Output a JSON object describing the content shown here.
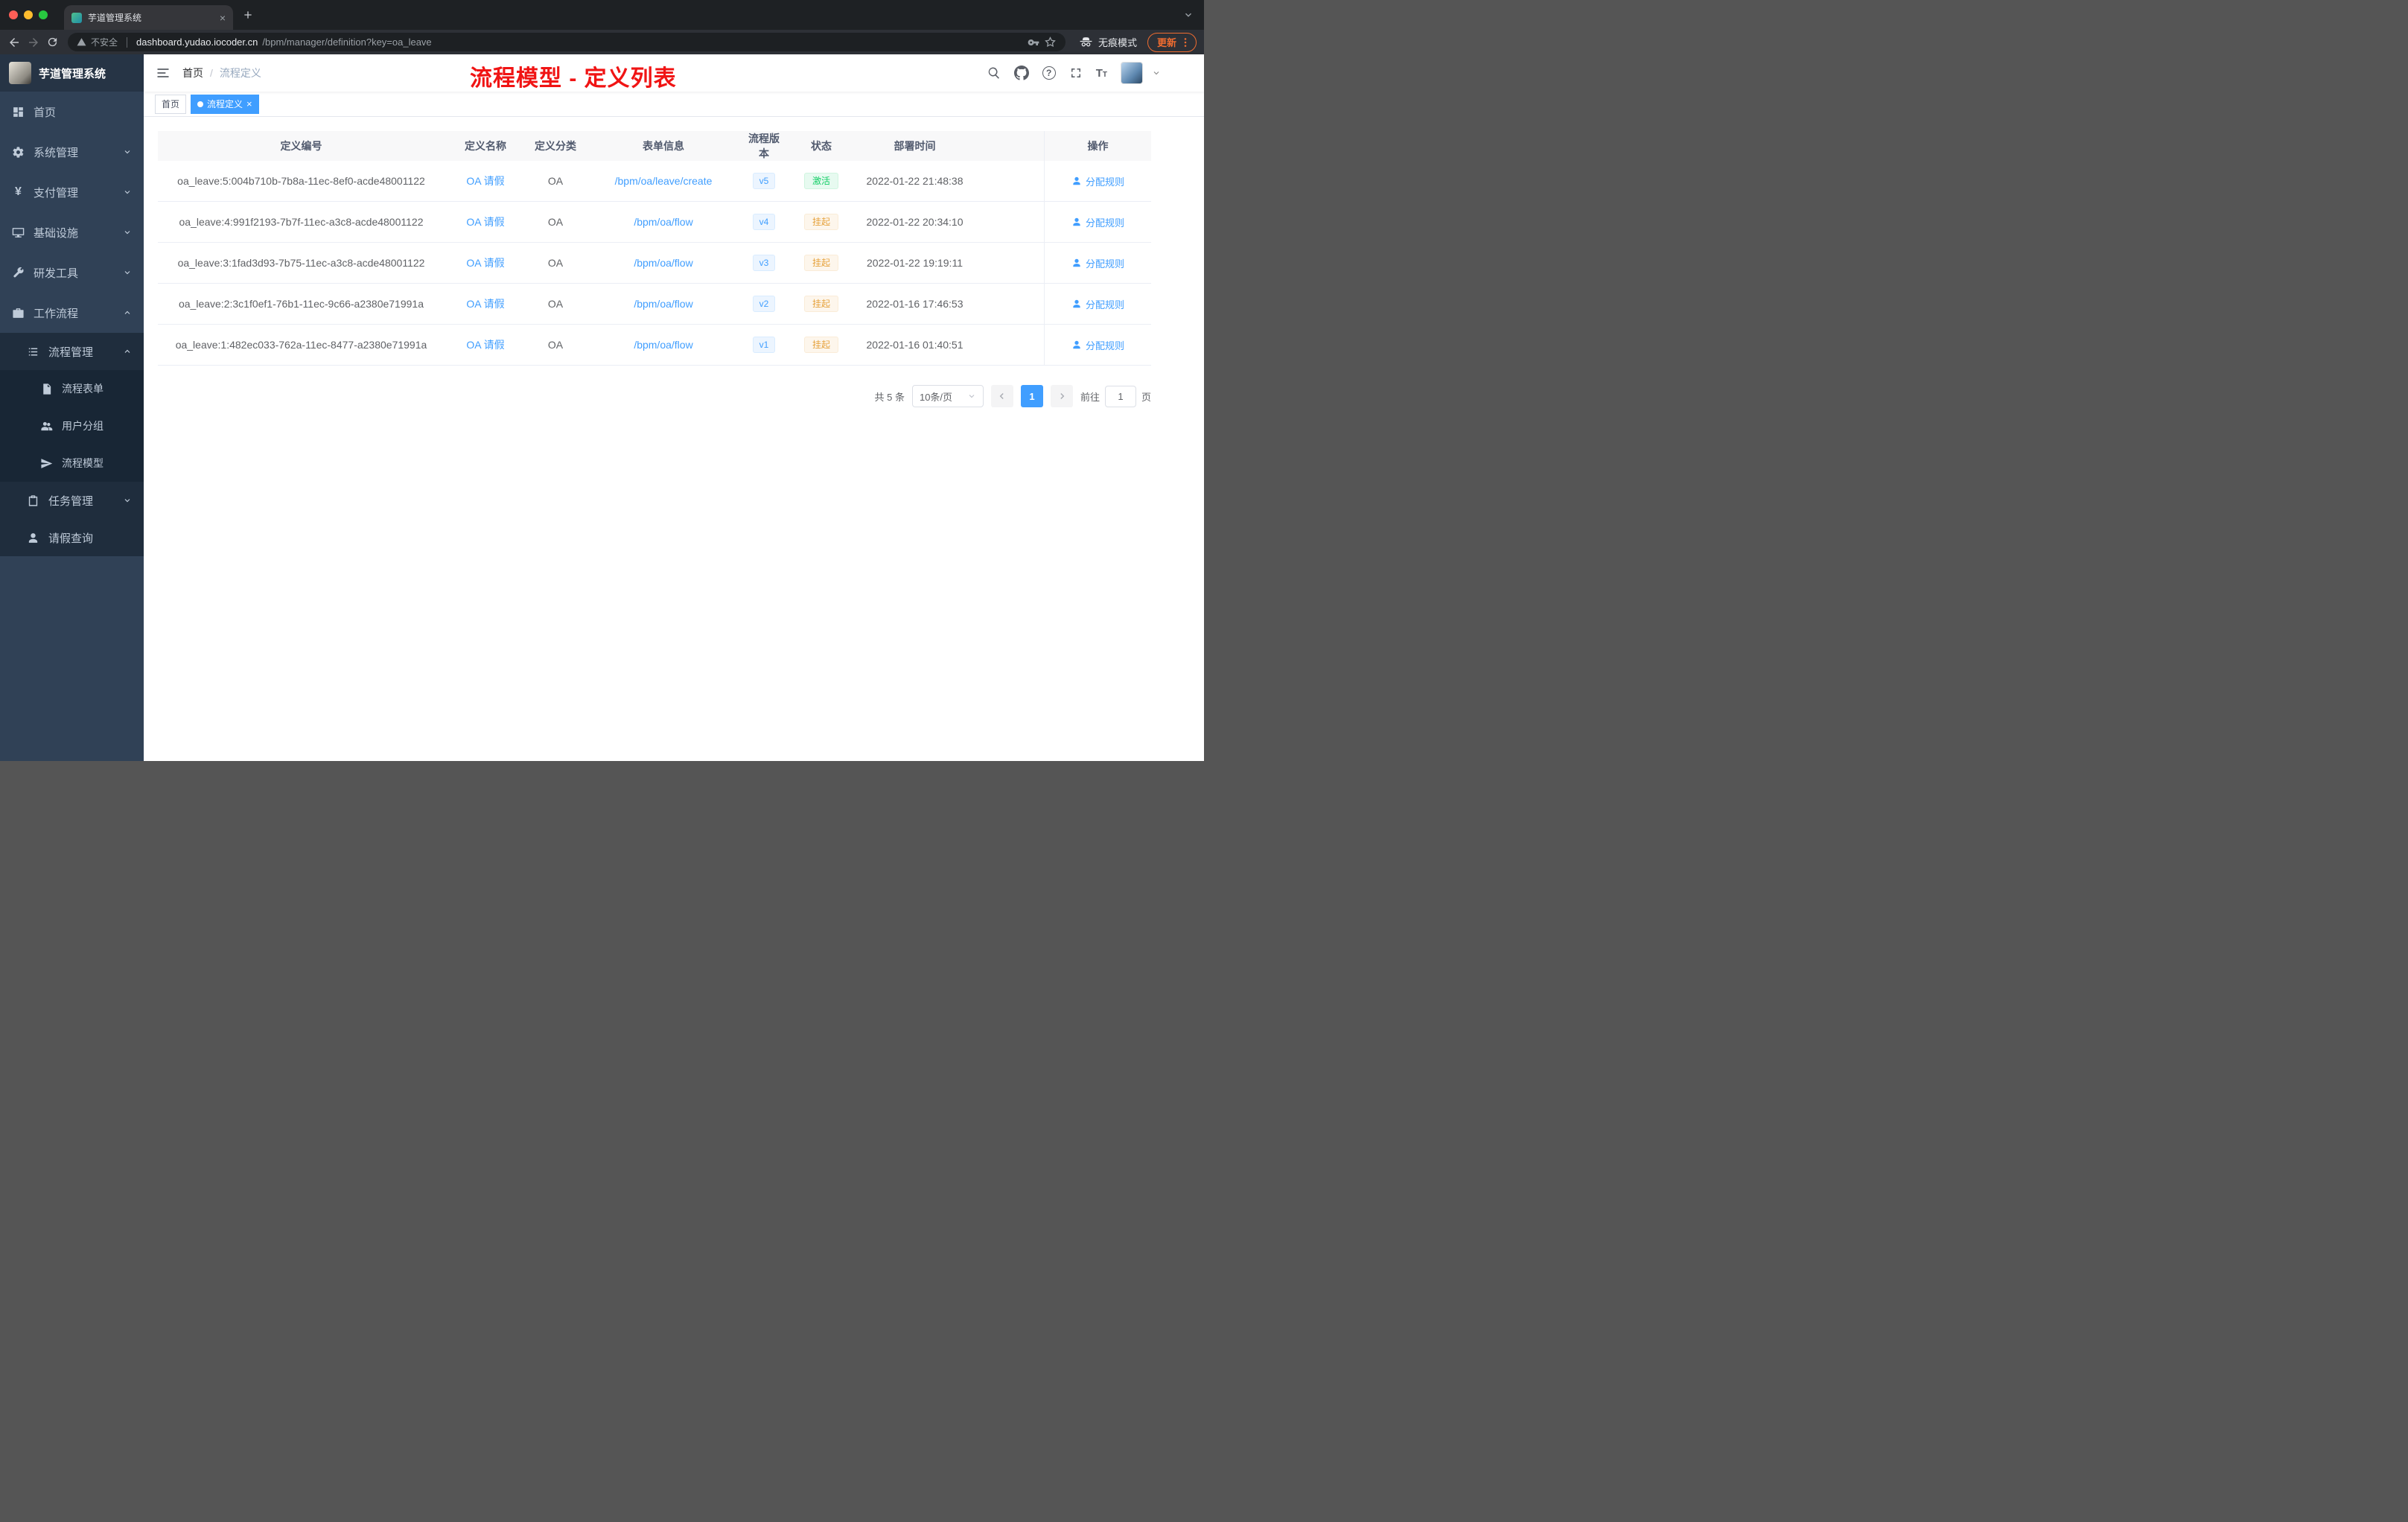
{
  "browser": {
    "tab_title": "芋道管理系统",
    "url_warning": "不安全",
    "url_host": "dashboard.yudao.iocoder.cn",
    "url_path": "/bpm/manager/definition?key=oa_leave",
    "incognito_label": "无痕模式",
    "update_label": "更新"
  },
  "icons": {
    "close_glyph": "×",
    "question_glyph": "?",
    "yen_glyph": "¥",
    "font_big": "T",
    "font_small": "T"
  },
  "sidebar": {
    "logo_title": "芋道管理系统",
    "items": [
      {
        "label": "首页",
        "icon": "dashboard-icon"
      },
      {
        "label": "系统管理",
        "icon": "gear-icon"
      },
      {
        "label": "支付管理",
        "icon": "yen-icon"
      },
      {
        "label": "基础设施",
        "icon": "monitor-icon"
      },
      {
        "label": "研发工具",
        "icon": "tool-icon"
      },
      {
        "label": "工作流程",
        "icon": "briefcase-icon"
      },
      {
        "label": "流程管理",
        "icon": "list-icon"
      },
      {
        "label": "流程表单",
        "icon": "document-icon"
      },
      {
        "label": "用户分组",
        "icon": "users-icon"
      },
      {
        "label": "流程模型",
        "icon": "send-icon"
      },
      {
        "label": "任务管理",
        "icon": "clipboard-icon"
      },
      {
        "label": "请假查询",
        "icon": "user-icon"
      }
    ]
  },
  "header": {
    "breadcrumb": [
      "首页",
      "流程定义"
    ],
    "breadcrumb_sep": "/",
    "annotation": "流程模型 - 定义列表"
  },
  "tags": [
    {
      "label": "首页"
    },
    {
      "label": "流程定义"
    }
  ],
  "table": {
    "headers": [
      "定义编号",
      "定义名称",
      "定义分类",
      "表单信息",
      "流程版本",
      "状态",
      "部署时间",
      "操作"
    ],
    "rows": [
      {
        "id": "oa_leave:5:004b710b-7b8a-11ec-8ef0-acde48001122",
        "name": "OA 请假",
        "category": "OA",
        "form": "/bpm/oa/leave/create",
        "version": "v5",
        "status": "激活",
        "status_type": "success",
        "time": "2022-01-22 21:48:38",
        "action": "分配规则"
      },
      {
        "id": "oa_leave:4:991f2193-7b7f-11ec-a3c8-acde48001122",
        "name": "OA 请假",
        "category": "OA",
        "form": "/bpm/oa/flow",
        "version": "v4",
        "status": "挂起",
        "status_type": "warning",
        "time": "2022-01-22 20:34:10",
        "action": "分配规则"
      },
      {
        "id": "oa_leave:3:1fad3d93-7b75-11ec-a3c8-acde48001122",
        "name": "OA 请假",
        "category": "OA",
        "form": "/bpm/oa/flow",
        "version": "v3",
        "status": "挂起",
        "status_type": "warning",
        "time": "2022-01-22 19:19:11",
        "action": "分配规则"
      },
      {
        "id": "oa_leave:2:3c1f0ef1-76b1-11ec-9c66-a2380e71991a",
        "name": "OA 请假",
        "category": "OA",
        "form": "/bpm/oa/flow",
        "version": "v2",
        "status": "挂起",
        "status_type": "warning",
        "time": "2022-01-16 17:46:53",
        "action": "分配规则"
      },
      {
        "id": "oa_leave:1:482ec033-762a-11ec-8477-a2380e71991a",
        "name": "OA 请假",
        "category": "OA",
        "form": "/bpm/oa/flow",
        "version": "v1",
        "status": "挂起",
        "status_type": "warning",
        "time": "2022-01-16 01:40:51",
        "action": "分配规则"
      }
    ]
  },
  "pagination": {
    "total": "共 5 条",
    "page_size": "10条/页",
    "current_page": "1",
    "goto_prefix": "前往",
    "goto_value": "1",
    "goto_suffix": "页"
  },
  "colors": {
    "accent_blue": "#409eff",
    "sidebar_bg": "#304156",
    "sidebar_sub_bg": "#1f2d3d",
    "annotation_red": "#f01414",
    "success_green": "#13ce66",
    "warning_orange": "#e6a23c",
    "update_orange": "#ef6c30"
  }
}
